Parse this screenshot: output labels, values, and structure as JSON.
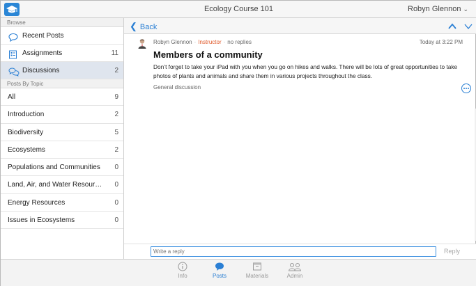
{
  "app": {
    "title": "Ecology Course 101",
    "user_name": "Robyn Glennon"
  },
  "sidebar": {
    "browse_header": "Browse",
    "nav": [
      {
        "label": "Recent Posts",
        "count": "",
        "icon": "speech-bubble-icon"
      },
      {
        "label": "Assignments",
        "count": "11",
        "icon": "assignments-list-icon"
      },
      {
        "label": "Discussions",
        "count": "2",
        "icon": "discussions-icon"
      }
    ],
    "topics_header": "Posts By Topic",
    "topics": [
      {
        "label": "All",
        "count": "9"
      },
      {
        "label": "Introduction",
        "count": "2"
      },
      {
        "label": "Biodiversity",
        "count": "5"
      },
      {
        "label": "Ecosystems",
        "count": "2"
      },
      {
        "label": "Populations and Communities",
        "count": "0"
      },
      {
        "label": "Land, Air, and Water Resour…",
        "count": "0"
      },
      {
        "label": "Energy Resources",
        "count": "0"
      },
      {
        "label": "Issues in Ecosystems",
        "count": "0"
      }
    ]
  },
  "toolbar": {
    "back_label": "Back"
  },
  "post": {
    "author": "Robyn Glennon",
    "role": "Instructor",
    "replies": "no replies",
    "time": "Today at 3:22 PM",
    "title": "Members of a community",
    "body": "Don’t forget to take your iPad with you when you go on hikes and walks. There will be lots of great opportunities to take photos of plants and animals and share them in various projects throughout the class.",
    "topic": "General discussion"
  },
  "reply": {
    "placeholder": "Write a reply",
    "button_label": "Reply"
  },
  "tabs": [
    {
      "label": "Info",
      "icon": "info-icon"
    },
    {
      "label": "Posts",
      "icon": "posts-icon"
    },
    {
      "label": "Materials",
      "icon": "materials-icon"
    },
    {
      "label": "Admin",
      "icon": "admin-icon"
    }
  ],
  "colors": {
    "accent": "#2a7fd4",
    "instructor": "#e0592a",
    "active_row": "#dfe5ee"
  }
}
